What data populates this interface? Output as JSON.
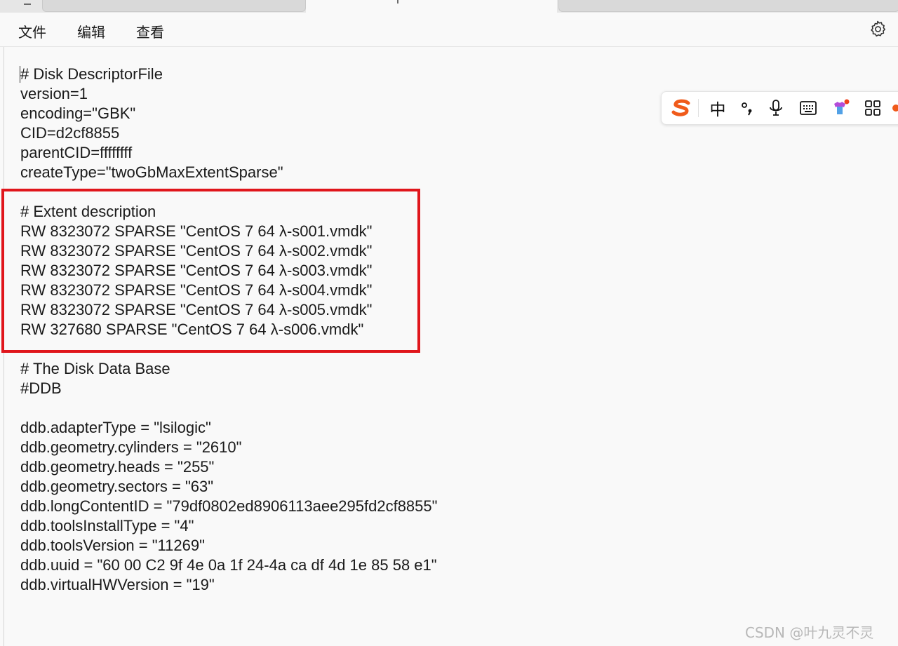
{
  "menu": {
    "file_label": "文件",
    "edit_label": "编辑",
    "view_label": "查看",
    "settings_icon": "gear-icon"
  },
  "document": {
    "lines": [
      "# Disk DescriptorFile",
      "version=1",
      "encoding=\"GBK\"",
      "CID=d2cf8855",
      "parentCID=ffffffff",
      "createType=\"twoGbMaxExtentSparse\"",
      "",
      "# Extent description",
      "RW 8323072 SPARSE \"CentOS 7 64 λ-s001.vmdk\"",
      "RW 8323072 SPARSE \"CentOS 7 64 λ-s002.vmdk\"",
      "RW 8323072 SPARSE \"CentOS 7 64 λ-s003.vmdk\"",
      "RW 8323072 SPARSE \"CentOS 7 64 λ-s004.vmdk\"",
      "RW 8323072 SPARSE \"CentOS 7 64 λ-s005.vmdk\"",
      "RW 327680 SPARSE \"CentOS 7 64 λ-s006.vmdk\"",
      "",
      "# The Disk Data Base",
      "#DDB",
      "",
      "ddb.adapterType = \"lsilogic\"",
      "ddb.geometry.cylinders = \"2610\"",
      "ddb.geometry.heads = \"255\"",
      "ddb.geometry.sectors = \"63\"",
      "ddb.longContentID = \"79df0802ed8906113aee295fd2cf8855\"",
      "ddb.toolsInstallType = \"4\"",
      "ddb.toolsVersion = \"11269\"",
      "ddb.uuid = \"60 00 C2 9f 4e 0a 1f 24-4a ca df 4d 1e 85 58 e1\"",
      "ddb.virtualHWVersion = \"19\""
    ]
  },
  "annotation": {
    "color": "#e0161c"
  },
  "ime_toolbar": {
    "mode_label": "中",
    "icons": [
      "sogou-logo-icon",
      "punctuation-icon",
      "microphone-icon",
      "keyboard-icon",
      "skin-icon",
      "apps-grid-icon"
    ],
    "logo_color": "#f05a1a"
  },
  "watermark": {
    "text": "CSDN @叶九灵不灵"
  }
}
